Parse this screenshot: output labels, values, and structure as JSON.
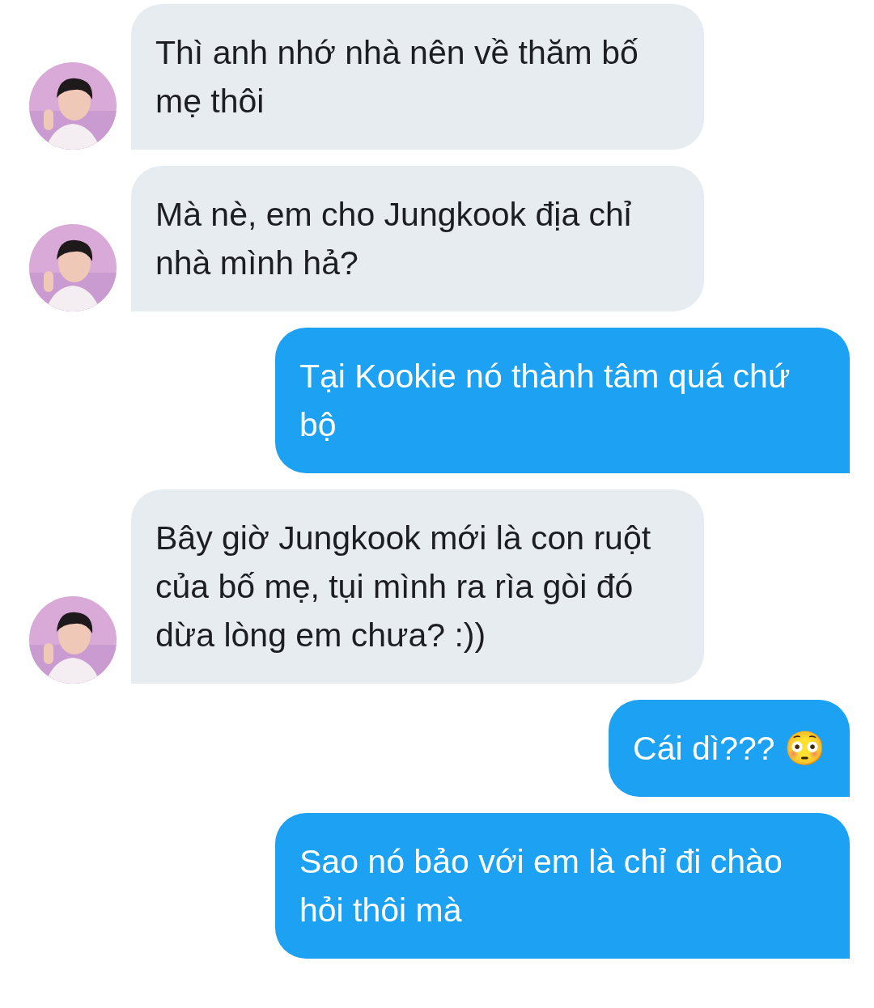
{
  "messages": [
    {
      "kind": "received",
      "text": "Thì anh nhớ nhà nên về thăm bố mẹ thôi"
    },
    {
      "kind": "received",
      "text": "Mà nè, em cho Jungkook địa chỉ nhà mình hả?"
    },
    {
      "kind": "sent",
      "text": "Tại Kookie nó thành tâm quá chứ bộ"
    },
    {
      "kind": "received",
      "text": "Bây giờ Jungkook mới là con ruột của bố mẹ, tụi mình ra rìa gòi đó dừa lòng em chưa? :))"
    },
    {
      "kind": "sent",
      "text": "Cái dì??? 😳"
    },
    {
      "kind": "sent",
      "text": "Sao nó bảo với em là chỉ đi chào hỏi thôi mà"
    }
  ]
}
